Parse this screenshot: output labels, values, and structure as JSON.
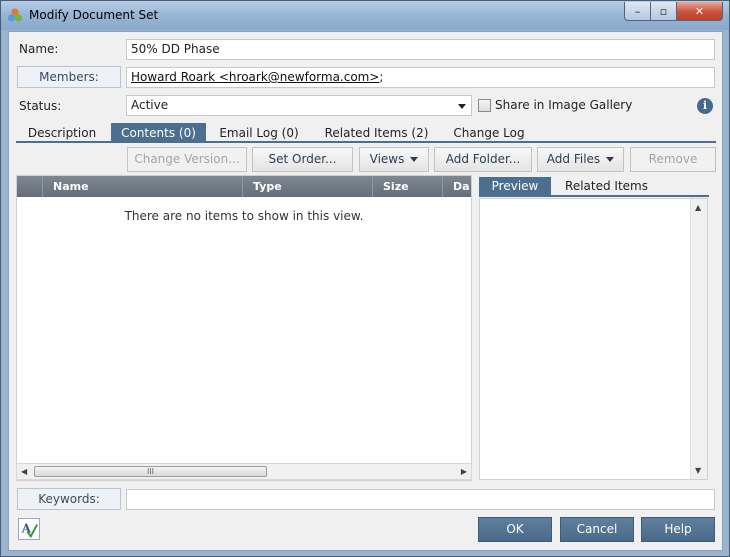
{
  "window": {
    "title": "Modify Document Set",
    "minimize": "–",
    "maximize": "▫",
    "close": "✕"
  },
  "form": {
    "name_label": "Name:",
    "name_value": "50% DD Phase",
    "members_label": "Members:",
    "members_value": "Howard Roark <hroark@newforma.com>",
    "members_separator": ";",
    "status_label": "Status:",
    "status_value": "Active",
    "share_label": "Share in Image Gallery",
    "share_checked": false,
    "info_glyph": "i"
  },
  "tabs": [
    {
      "label": "Description",
      "active": false
    },
    {
      "label": "Contents (0)",
      "active": true
    },
    {
      "label": "Email Log (0)",
      "active": false
    },
    {
      "label": "Related Items (2)",
      "active": false
    },
    {
      "label": "Change Log",
      "active": false
    }
  ],
  "toolbar": {
    "change_version": "Change Version...",
    "set_order": "Set Order...",
    "views": "Views",
    "add_folder": "Add Folder...",
    "add_files": "Add Files",
    "remove": "Remove"
  },
  "grid": {
    "columns": [
      "Name",
      "Type",
      "Size",
      "Da"
    ],
    "empty_message": "There are no items to show in this view.",
    "scroll_grip": "III",
    "scroll_left": "◀",
    "scroll_right": "▶"
  },
  "preview": {
    "tabs": [
      {
        "label": "Preview",
        "active": true
      },
      {
        "label": "Related Items",
        "active": false
      }
    ],
    "scroll_up": "▲",
    "scroll_down": "▼"
  },
  "keywords": {
    "label": "Keywords:",
    "value": ""
  },
  "buttons": {
    "ok": "OK",
    "cancel": "Cancel",
    "help": "Help"
  },
  "colors": {
    "accent": "#4d6f8f",
    "title_bar": "#9ab6d6",
    "close_button": "#c8533c"
  }
}
